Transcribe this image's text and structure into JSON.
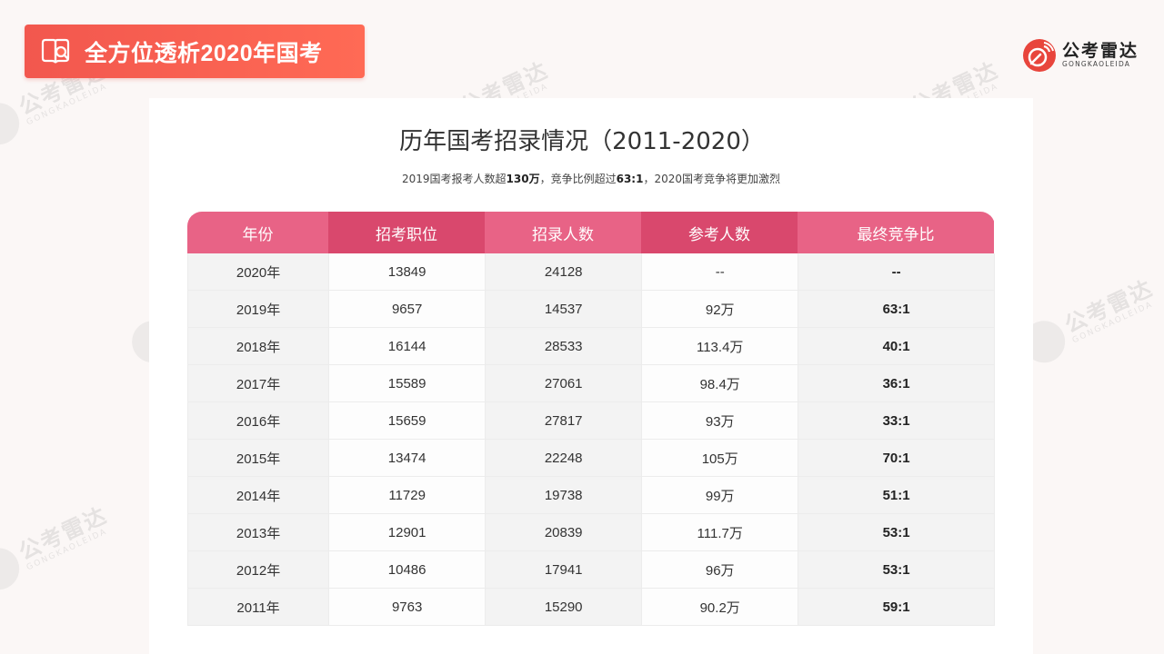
{
  "banner": {
    "title": "全方位透析2020年国考",
    "icon": "book-search-icon"
  },
  "logo": {
    "name": "公考雷达",
    "sub": "GONGKAOLEIDA",
    "icon": "radar-logo-icon"
  },
  "watermark": {
    "name": "公考雷达",
    "sub": "GONGKAOLEIDA"
  },
  "page": {
    "title": "历年国考招录情况（2011-2020）",
    "subtitle_parts": [
      "2019国考报考人数超",
      "130万",
      "，竞争比例超过",
      "63:1",
      "，2020国考竞争将更加激烈"
    ]
  },
  "table": {
    "headers": [
      "年份",
      "招考职位",
      "招录人数",
      "参考人数",
      "最终竞争比"
    ],
    "rows": [
      [
        "2020年",
        "13849",
        "24128",
        "--",
        "--"
      ],
      [
        "2019年",
        "9657",
        "14537",
        "92万",
        "63:1"
      ],
      [
        "2018年",
        "16144",
        "28533",
        "113.4万",
        "40:1"
      ],
      [
        "2017年",
        "15589",
        "27061",
        "98.4万",
        "36:1"
      ],
      [
        "2016年",
        "15659",
        "27817",
        "93万",
        "33:1"
      ],
      [
        "2015年",
        "13474",
        "22248",
        "105万",
        "70:1"
      ],
      [
        "2014年",
        "11729",
        "19738",
        "99万",
        "51:1"
      ],
      [
        "2013年",
        "12901",
        "20839",
        "111.7万",
        "53:1"
      ],
      [
        "2012年",
        "10486",
        "17941",
        "96万",
        "53:1"
      ],
      [
        "2011年",
        "9763",
        "15290",
        "90.2万",
        "59:1"
      ]
    ]
  },
  "colors": {
    "banner": "#f2574e",
    "header_light": "#e86386",
    "header_dark": "#d9486d"
  }
}
